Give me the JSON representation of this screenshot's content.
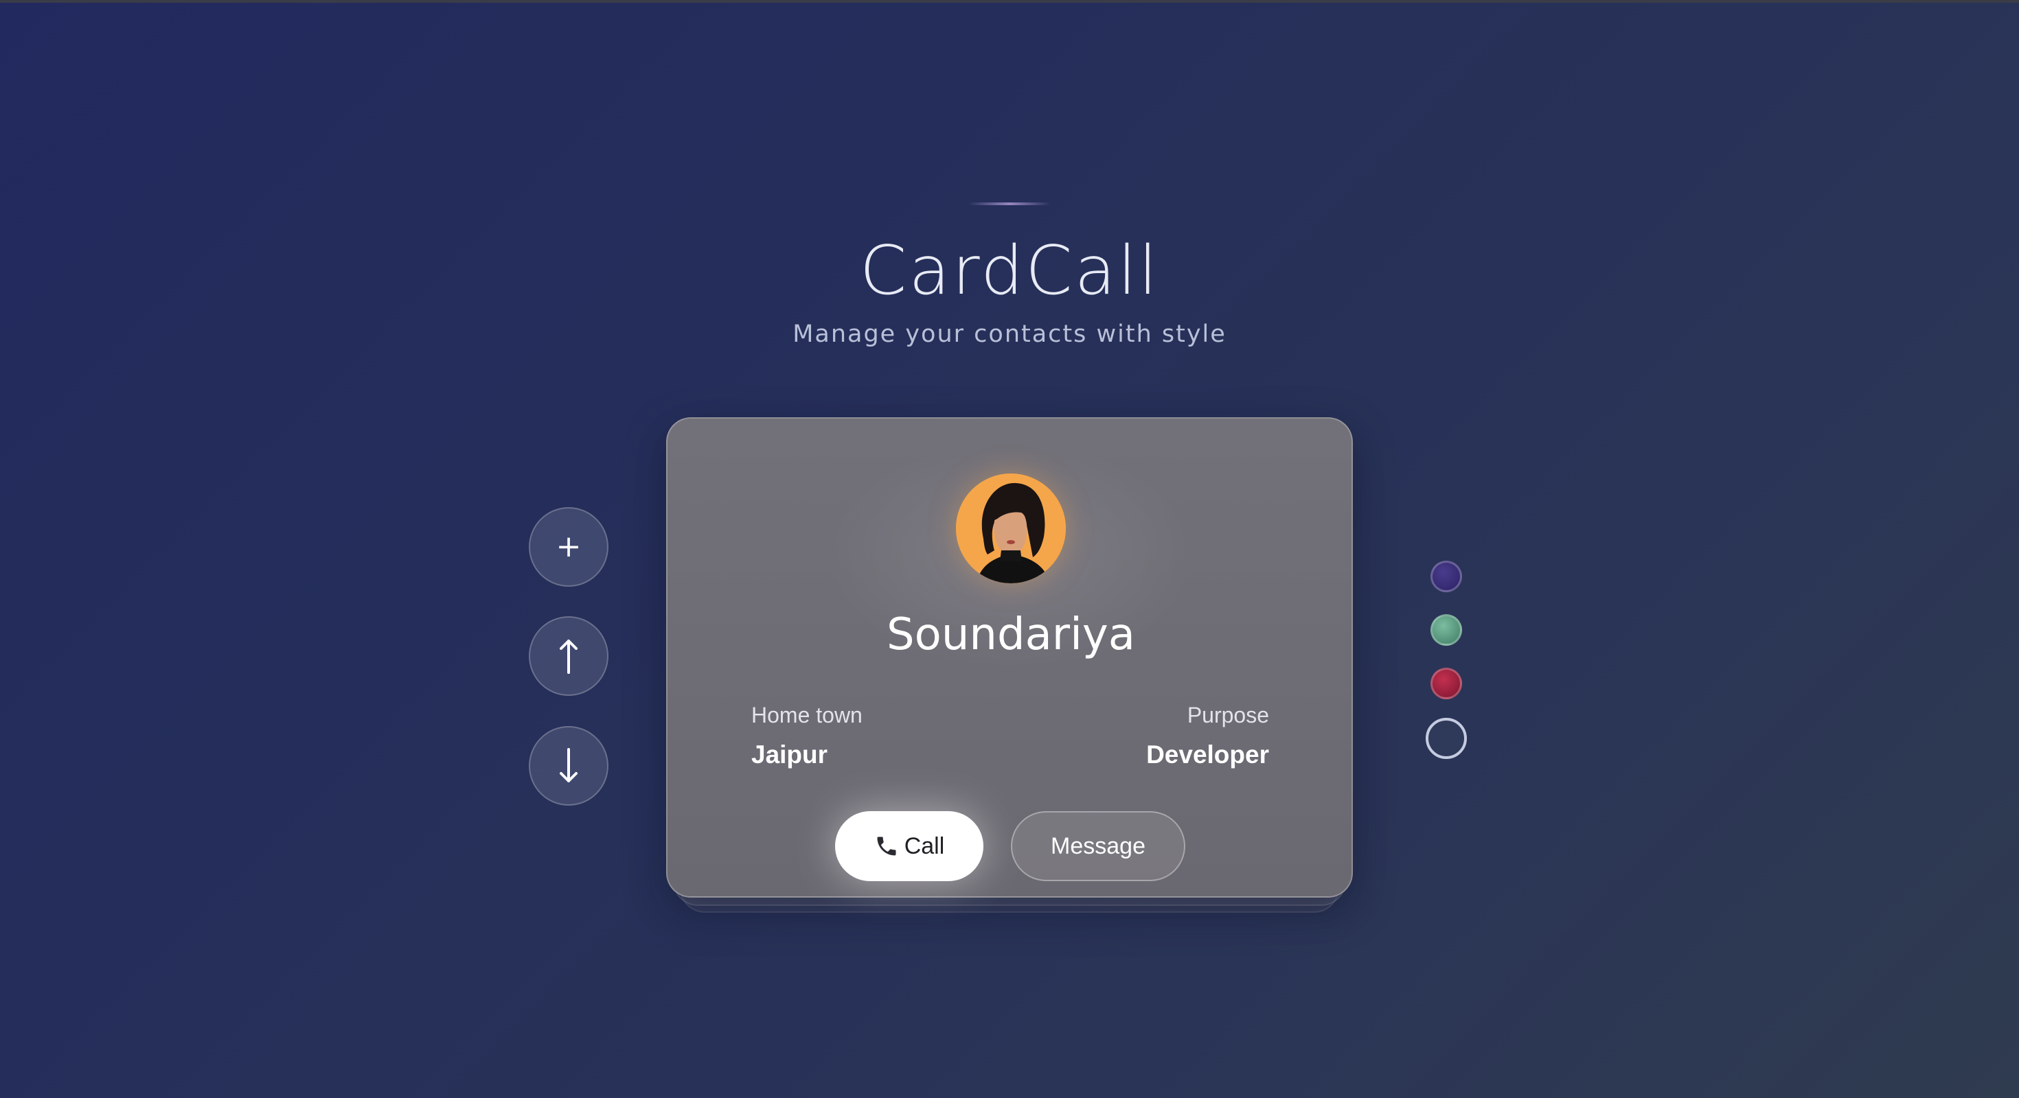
{
  "header": {
    "title": "CardCall",
    "subtitle": "Manage your contacts with style"
  },
  "side_controls": {
    "add_label": "+",
    "up_icon": "arrow-up-icon",
    "down_icon": "arrow-down-icon"
  },
  "contact": {
    "name": "Soundariya",
    "hometown_label": "Home town",
    "hometown_value": "Jaipur",
    "purpose_label": "Purpose",
    "purpose_value": "Developer",
    "avatar_icon": "profile-photo"
  },
  "actions": {
    "call_label": "Call",
    "message_label": "Message",
    "call_icon": "phone-icon"
  },
  "themes": [
    {
      "name": "indigo",
      "color": "#3b2f7a"
    },
    {
      "name": "teal",
      "color": "#5f9e84"
    },
    {
      "name": "crimson",
      "color": "#a1203e"
    },
    {
      "name": "slate",
      "color": "#2f3a5a"
    }
  ]
}
